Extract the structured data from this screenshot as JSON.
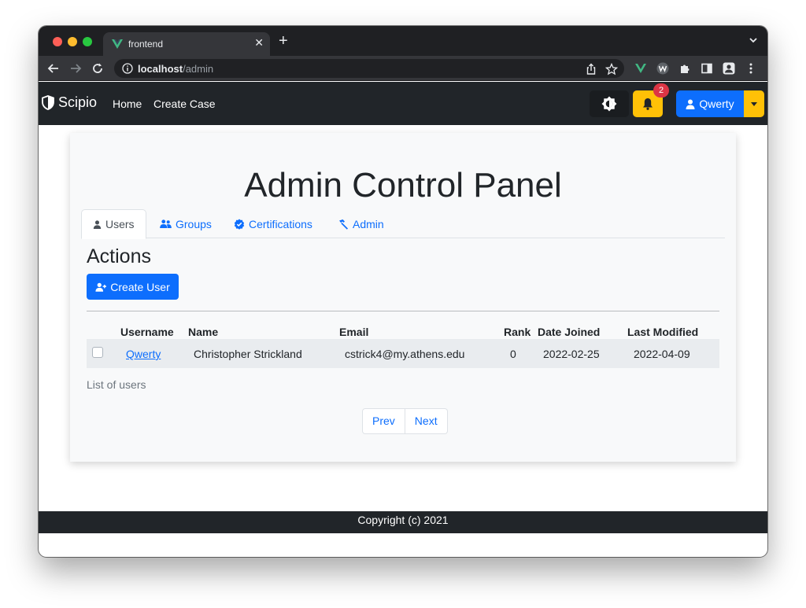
{
  "browser": {
    "tab_title": "frontend",
    "url_host": "localhost",
    "url_path": "/admin"
  },
  "navbar": {
    "brand": "Scipio",
    "links": [
      "Home",
      "Create Case"
    ],
    "notification_count": "2",
    "user_name": "Qwerty"
  },
  "page": {
    "title": "Admin Control Panel",
    "tabs": [
      "Users",
      "Groups",
      "Certifications",
      "Admin"
    ],
    "active_tab": "Users",
    "actions_heading": "Actions",
    "create_user_label": "Create User"
  },
  "table": {
    "columns": [
      "Username",
      "Name",
      "Email",
      "Rank",
      "Date Joined",
      "Last Modified"
    ],
    "rows": [
      {
        "username": "Qwerty",
        "name": "Christopher Strickland",
        "email": "cstrick4@my.athens.edu",
        "rank": "0",
        "date_joined": "2022-02-25",
        "last_modified": "2022-04-09"
      }
    ],
    "caption": "List of users"
  },
  "pagination": {
    "prev": "Prev",
    "next": "Next"
  },
  "footer": {
    "text": "Copyright (c) 2021"
  },
  "colors": {
    "primary": "#0d6efd",
    "warning": "#ffc107",
    "danger": "#dc3545",
    "dark": "#212529"
  }
}
